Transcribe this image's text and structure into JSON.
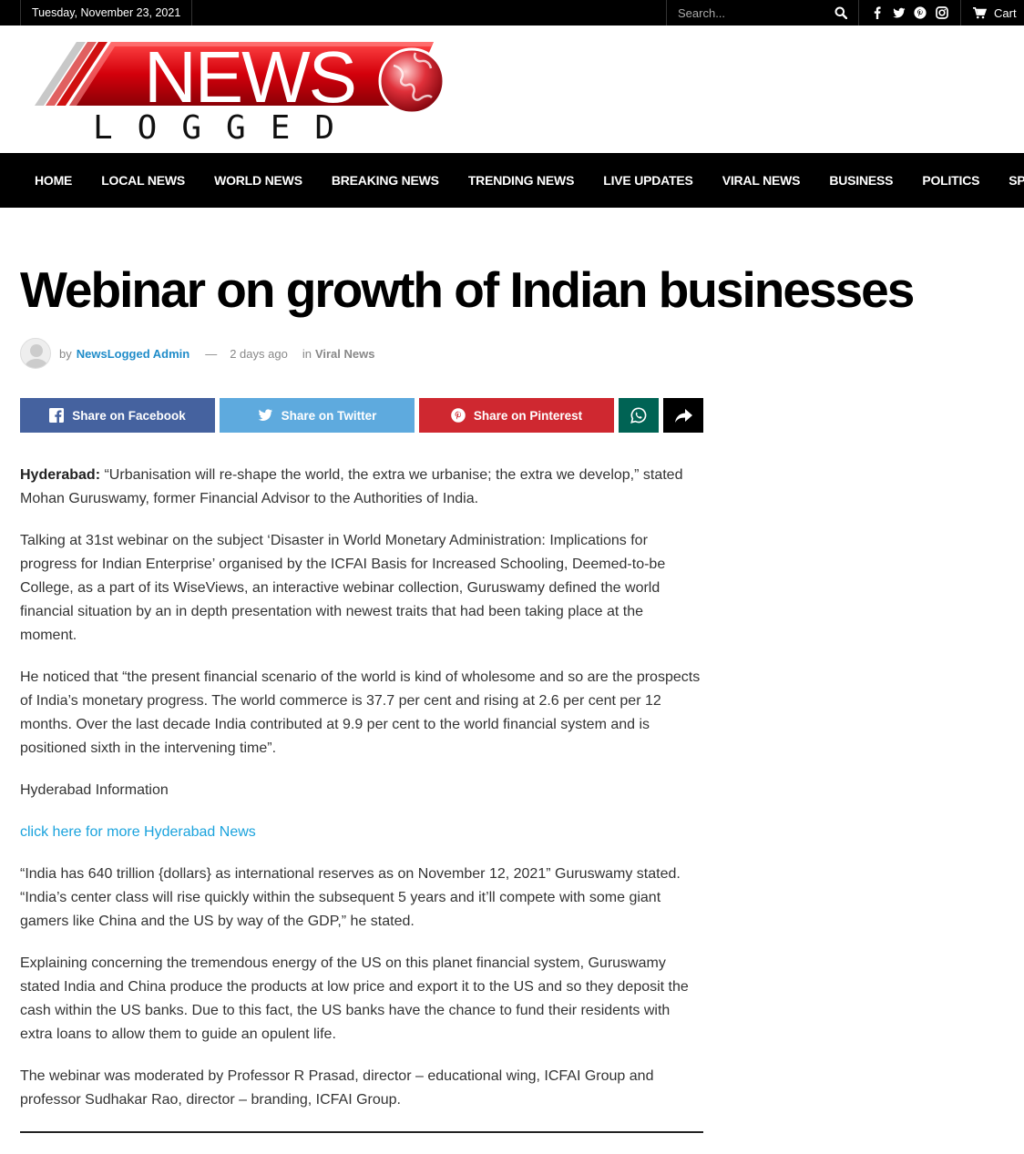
{
  "topbar": {
    "date": "Tuesday, November 23, 2021",
    "search_placeholder": "Search...",
    "cart_label": "Cart",
    "social_icons": [
      "facebook-icon",
      "twitter-icon",
      "pinterest-icon",
      "instagram-icon"
    ]
  },
  "logo": {
    "news_text": "NEWS",
    "logged_text": "LOGGED"
  },
  "nav": {
    "items": [
      "HOME",
      "LOCAL NEWS",
      "WORLD NEWS",
      "BREAKING NEWS",
      "TRENDING NEWS",
      "LIVE UPDATES",
      "VIRAL NEWS",
      "BUSINESS",
      "POLITICS",
      "SPORTS"
    ]
  },
  "article": {
    "title": "Webinar on growth of Indian businesses",
    "by": "by",
    "author": "NewsLogged Admin",
    "dash": "—",
    "time": "2 days ago",
    "in": "in",
    "category": "Viral News",
    "share": {
      "facebook": "Share on Facebook",
      "twitter": "Share on Twitter",
      "pinterest": "Share on Pinterest"
    },
    "p1_lead": "Hyderabad:",
    "p1": " “Urbanisation will re-shape the world, the extra we urbanise; the extra we develop,” stated Mohan Guruswamy, former Financial Advisor to the Authorities of India.",
    "p2": "Talking at 31st webinar on the subject ‘Disaster in World Monetary Administration: Implications for progress for Indian Enterprise’ organised by the ICFAI Basis for Increased Schooling, Deemed-to-be College, as a part of its WiseViews, an interactive webinar collection, Guruswamy defined the world financial situation by an in depth presentation with newest traits that had been taking place at the moment.",
    "p3": "He noticed that “the present financial scenario of the world is kind of wholesome and so are the prospects of India’s monetary progress. The world commerce is 37.7 per cent and rising at 2.6 per cent per 12 months. Over the last decade India contributed at 9.9 per cent to the world financial system and is positioned sixth in the intervening time”.",
    "p4": "Hyderabad Information",
    "link": "click here for more Hyderabad News",
    "p5": "“India has 640 trillion {dollars} as international reserves as on November 12, 2021” Guruswamy stated. “India’s center class will rise quickly within the subsequent 5 years and it’ll compete with some giant gamers like China and the US by way of the GDP,” he stated.",
    "p6": "Explaining concerning the tremendous energy of the US on this planet financial system, Guruswamy stated India and China produce the products at low price and export it to the US and so they deposit the cash within the US banks. Due to this fact, the US banks have the chance to fund their residents with extra loans to allow them to guide an opulent life.",
    "p7": "The webinar was moderated by Professor R Prasad, director – educational wing, ICFAI Group and professor Sudhakar Rao, director – branding, ICFAI Group."
  },
  "colors": {
    "facebook": "#45629f",
    "twitter": "#5eaade",
    "pinterest": "#cf2830",
    "whatsapp": "#006354",
    "link": "#1ba3dd",
    "author": "#1f8cc9"
  }
}
